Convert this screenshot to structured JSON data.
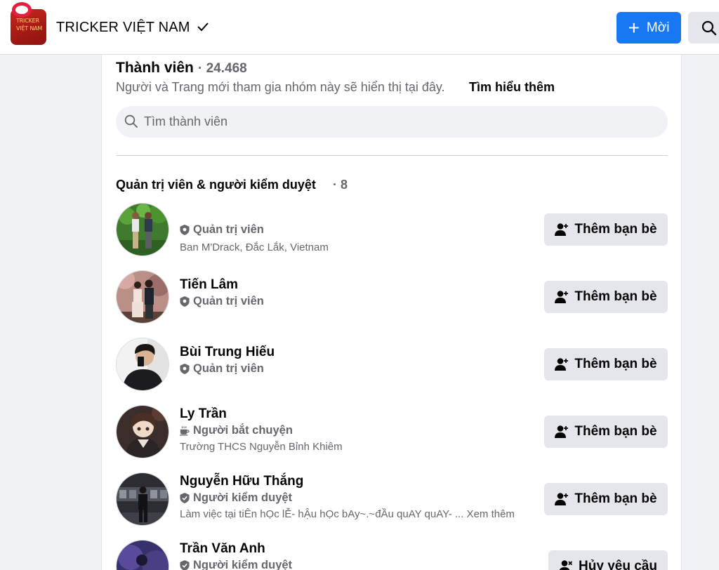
{
  "header": {
    "group_logo_text": "TRICKER VIỆT NAM",
    "group_name": "TRICKER VIỆT NAM",
    "new_button_label": "Mời",
    "icons": [
      "notification-dot",
      "verified-check-icon",
      "plus-icon",
      "search-icon"
    ]
  },
  "members_section": {
    "title": "Thành viên",
    "count": "· 24.468",
    "description": "Người và Trang mới tham gia nhóm này sẽ hiển thị tại đây.",
    "learn_more": "Tìm hiểu thêm",
    "search_placeholder": "Tìm thành viên"
  },
  "admins_section": {
    "title": "Quản trị viên & người kiểm duyệt",
    "count": "· 8",
    "members": [
      {
        "name": "",
        "role": "Quản trị viên",
        "role_icon": "shield-icon",
        "detail": "Ban M'Drack, Đắc Lắk, Vietnam",
        "action": "Thêm bạn bè",
        "action_icon": "add-friend-icon"
      },
      {
        "name": "Tiến Lâm",
        "role": "Quản trị viên",
        "role_icon": "shield-icon",
        "detail": "",
        "action": "Thêm bạn bè",
        "action_icon": "add-friend-icon"
      },
      {
        "name": "Bùi Trung Hiếu",
        "role": "Quản trị viên",
        "role_icon": "shield-icon",
        "detail": "",
        "action": "Thêm bạn bè",
        "action_icon": "add-friend-icon"
      },
      {
        "name": "Ly Trần",
        "role": "Người bắt chuyện",
        "role_icon": "coffee-cup-icon",
        "detail": "Trường THCS Nguyễn Bỉnh Khiêm",
        "action": "Thêm bạn bè",
        "action_icon": "add-friend-icon"
      },
      {
        "name": "Nguyễn Hữu Thắng",
        "role": "Người kiểm duyệt",
        "role_icon": "shield-check-icon",
        "detail": "Làm việc tại tiÊn hỌc lỄ- hẬu hỌc bAy~.~đẦu quAY quAY- ... Xem thêm",
        "action": "Thêm bạn bè",
        "action_icon": "add-friend-icon"
      },
      {
        "name": "Trần Văn Anh",
        "role": "Người kiểm duyệt",
        "role_icon": "shield-check-icon",
        "detail": "",
        "action": "Hủy yêu cầu",
        "action_icon": "cancel-request-icon"
      }
    ]
  },
  "colors": {
    "accent": "#1877f2",
    "page_background": "#f0f2f5",
    "secondary_text": "#65676b",
    "button_gray": "#e4e6eb"
  }
}
